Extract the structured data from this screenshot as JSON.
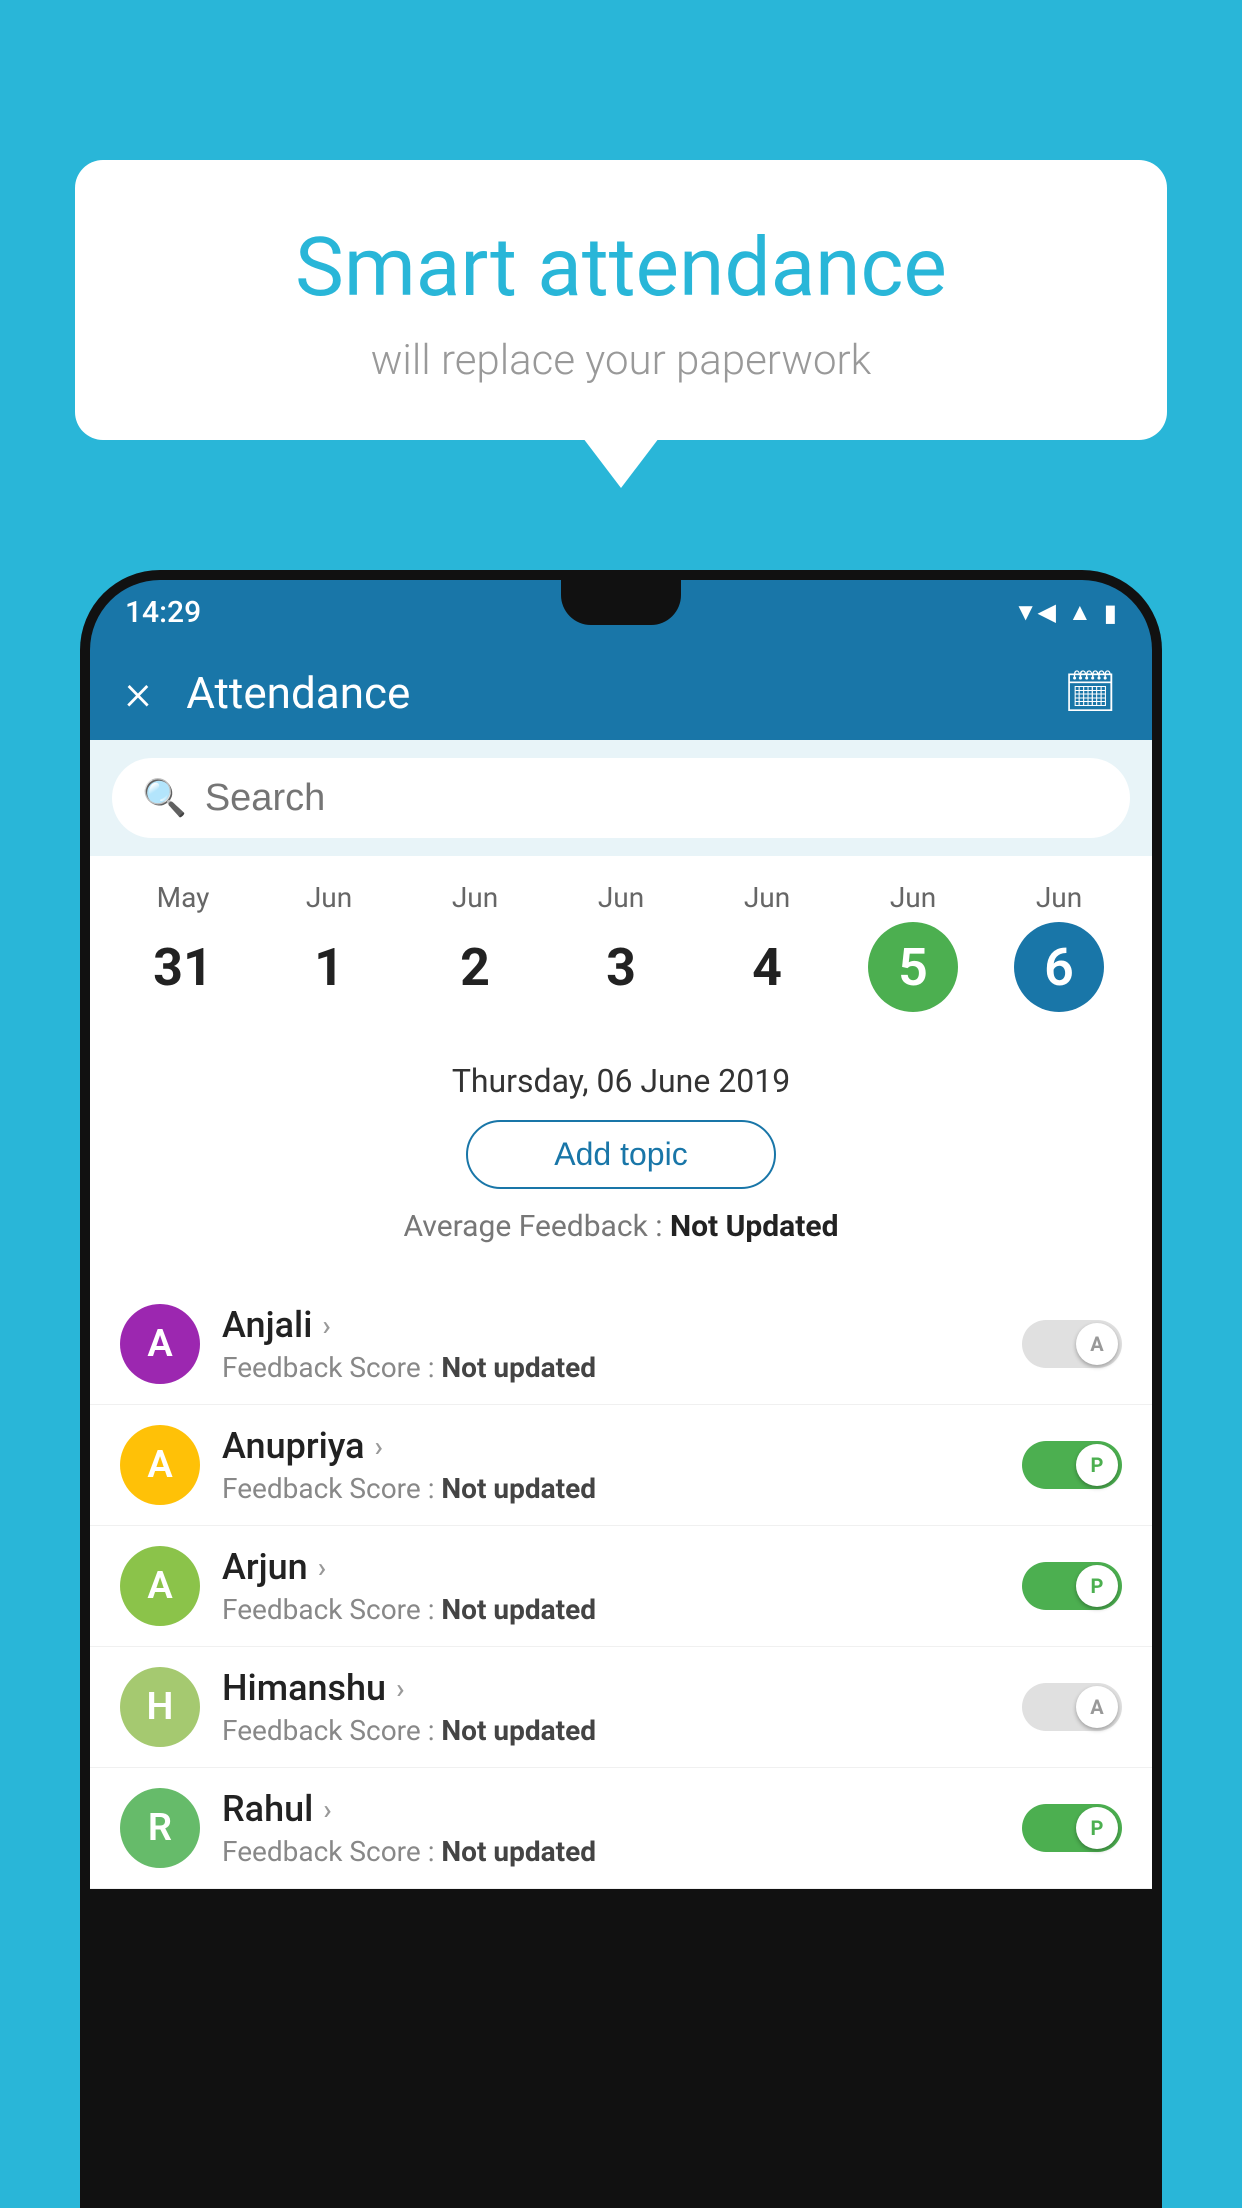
{
  "background_color": "#29b6d8",
  "speech_bubble": {
    "title": "Smart attendance",
    "subtitle": "will replace your paperwork"
  },
  "status_bar": {
    "time": "14:29",
    "signal_icon": "▲",
    "wifi_icon": "▼",
    "battery_icon": "▮"
  },
  "app_bar": {
    "title": "Attendance",
    "close_label": "×",
    "calendar_icon": "📅"
  },
  "search": {
    "placeholder": "Search"
  },
  "date_selector": {
    "dates": [
      {
        "month": "May",
        "day": "31",
        "state": "normal"
      },
      {
        "month": "Jun",
        "day": "1",
        "state": "normal"
      },
      {
        "month": "Jun",
        "day": "2",
        "state": "normal"
      },
      {
        "month": "Jun",
        "day": "3",
        "state": "normal"
      },
      {
        "month": "Jun",
        "day": "4",
        "state": "normal"
      },
      {
        "month": "Jun",
        "day": "5",
        "state": "today"
      },
      {
        "month": "Jun",
        "day": "6",
        "state": "selected"
      }
    ]
  },
  "selected_date_label": "Thursday, 06 June 2019",
  "add_topic_label": "Add topic",
  "avg_feedback": {
    "label": "Average Feedback : ",
    "value": "Not Updated"
  },
  "students": [
    {
      "name": "Anjali",
      "avatar_letter": "A",
      "avatar_color": "#9c27b0",
      "feedback_label": "Feedback Score : ",
      "feedback_value": "Not updated",
      "toggle_state": "off",
      "toggle_label": "A"
    },
    {
      "name": "Anupriya",
      "avatar_letter": "A",
      "avatar_color": "#ffc107",
      "feedback_label": "Feedback Score : ",
      "feedback_value": "Not updated",
      "toggle_state": "on",
      "toggle_label": "P"
    },
    {
      "name": "Arjun",
      "avatar_letter": "A",
      "avatar_color": "#8bc34a",
      "feedback_label": "Feedback Score : ",
      "feedback_value": "Not updated",
      "toggle_state": "on",
      "toggle_label": "P"
    },
    {
      "name": "Himanshu",
      "avatar_letter": "H",
      "avatar_color": "#a5c970",
      "feedback_label": "Feedback Score : ",
      "feedback_value": "Not updated",
      "toggle_state": "off",
      "toggle_label": "A"
    },
    {
      "name": "Rahul",
      "avatar_letter": "R",
      "avatar_color": "#66bb6a",
      "feedback_label": "Feedback Score : ",
      "feedback_value": "Not updated",
      "toggle_state": "on",
      "toggle_label": "P"
    }
  ]
}
